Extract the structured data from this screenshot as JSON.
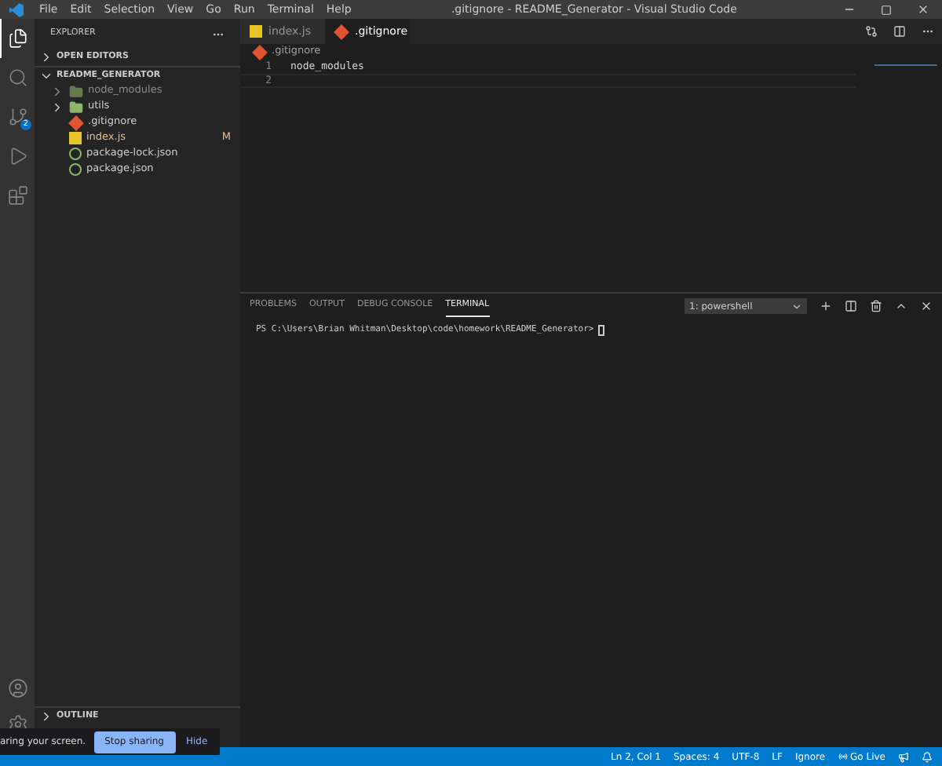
{
  "menu": [
    "File",
    "Edit",
    "Selection",
    "View",
    "Go",
    "Run",
    "Terminal",
    "Help"
  ],
  "window_title": ".gitignore - README_Generator - Visual Studio Code",
  "activity": [
    {
      "kind": "files",
      "selected": true
    },
    {
      "kind": "search",
      "selected": false
    },
    {
      "kind": "git",
      "selected": false,
      "badge": "2"
    },
    {
      "kind": "run",
      "selected": false
    },
    {
      "kind": "extensions",
      "selected": false
    }
  ],
  "explorer": {
    "title": "EXPLORER",
    "open_editors": {
      "label": "OPEN EDITORS",
      "expanded": false
    },
    "root": {
      "label": "README_GENERATOR",
      "expanded": true,
      "children": [
        {
          "name": "node_modules",
          "kind": "folder",
          "expanded": false,
          "dimmed": true
        },
        {
          "name": "utils",
          "kind": "folder",
          "expanded": false,
          "dimmed": false
        },
        {
          "name": ".gitignore",
          "kind": "git",
          "dimmed": false
        },
        {
          "name": "index.js",
          "kind": "js",
          "dimmed": false,
          "status": "M"
        },
        {
          "name": "package-lock.json",
          "kind": "json",
          "dimmed": false
        },
        {
          "name": "package.json",
          "kind": "json",
          "dimmed": false
        }
      ]
    },
    "outline": {
      "label": "OUTLINE",
      "expanded": false
    }
  },
  "tabs": [
    {
      "label": "index.js",
      "kind": "js",
      "selected": false
    },
    {
      "label": ".gitignore",
      "kind": "git",
      "selected": true
    }
  ],
  "breadcrumb": {
    "label": ".gitignore",
    "kind": "git"
  },
  "lines": [
    {
      "number": "1",
      "text": "node_modules"
    },
    {
      "number": "2"
    }
  ],
  "panel": {
    "tabs": [
      {
        "label": "PROBLEMS",
        "selected": false
      },
      {
        "label": "OUTPUT",
        "selected": false
      },
      {
        "label": "DEBUG CONSOLE",
        "selected": false
      },
      {
        "label": "TERMINAL",
        "selected": true
      }
    ],
    "terminal_select": "1: powershell",
    "prompt": "PS C:\\Users\\Brian Whitman\\Desktop\\code\\homework\\README_Generator>"
  },
  "share": {
    "message": "aring your screen.",
    "stop": "Stop sharing",
    "hide": "Hide"
  },
  "status_bar": [
    "Ln 2, Col 1",
    "Spaces: 4",
    "UTF-8",
    "LF",
    "Ignore",
    "Go Live"
  ]
}
